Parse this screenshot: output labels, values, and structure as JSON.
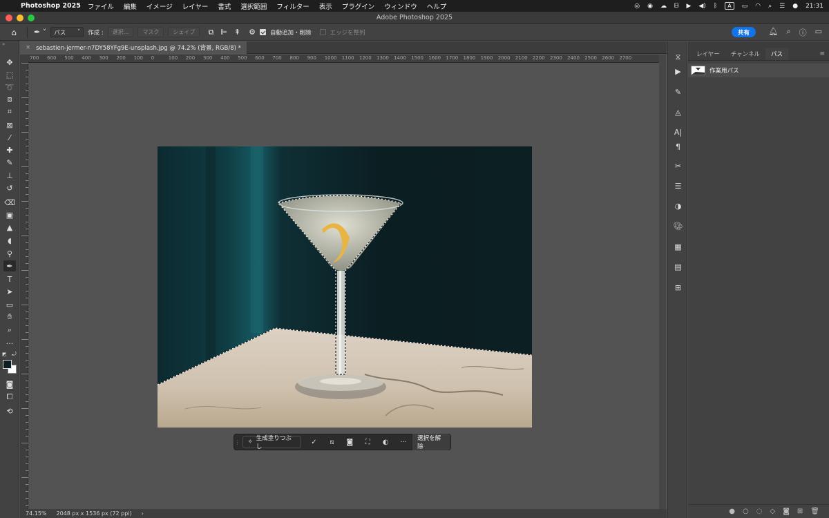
{
  "menubar": {
    "app_name": "Photoshop 2025",
    "items": [
      "ファイル",
      "編集",
      "イメージ",
      "レイヤー",
      "書式",
      "選択範囲",
      "フィルター",
      "表示",
      "プラグイン",
      "ウィンドウ",
      "ヘルプ"
    ],
    "input_mode": "A",
    "clock": "21:31"
  },
  "window": {
    "title": "Adobe Photoshop 2025"
  },
  "options": {
    "mode_select": "パス",
    "create_label": "作成 :",
    "select_btn": "選択...",
    "mask_btn": "マスク",
    "shape_btn": "シェイプ",
    "auto_add_label": "自動追加・削除",
    "align_edges_label": "エッジを整列",
    "share_label": "共有"
  },
  "document": {
    "tab_title": "sebastien-jermer-n7DY58YFg9E-unsplash.jpg @ 74.2% (背景, RGB/8) *",
    "close_icon": "×"
  },
  "ruler_top_labels": [
    "700",
    "600",
    "500",
    "400",
    "300",
    "200",
    "100",
    "0",
    "100",
    "200",
    "300",
    "400",
    "500",
    "600",
    "700",
    "800",
    "900",
    "1000",
    "1100",
    "1200",
    "1300",
    "1400",
    "1500",
    "1600",
    "1700",
    "1800",
    "1900",
    "2000",
    "2100",
    "2200",
    "2300",
    "2400",
    "2500",
    "2600",
    "2700"
  ],
  "context_bar": {
    "gen_fill": "生成塗りつぶし",
    "deselect": "選択を解除",
    "icons": [
      "brush-select-icon",
      "invert-icon",
      "mask-icon",
      "fill-icon",
      "adjust-icon",
      "more-icon"
    ]
  },
  "status": {
    "zoom": "74.15%",
    "size": "2048 px x 1536 px (72 ppi)",
    "arrow": "›"
  },
  "panel": {
    "tabs": [
      "レイヤー",
      "チャンネル",
      "パス"
    ],
    "active_tab": "パス",
    "path_item": "作業用パス"
  },
  "colors": {
    "accent": "#1473e6",
    "ui_dark": "#424242",
    "canvas_bg": "#535353"
  }
}
